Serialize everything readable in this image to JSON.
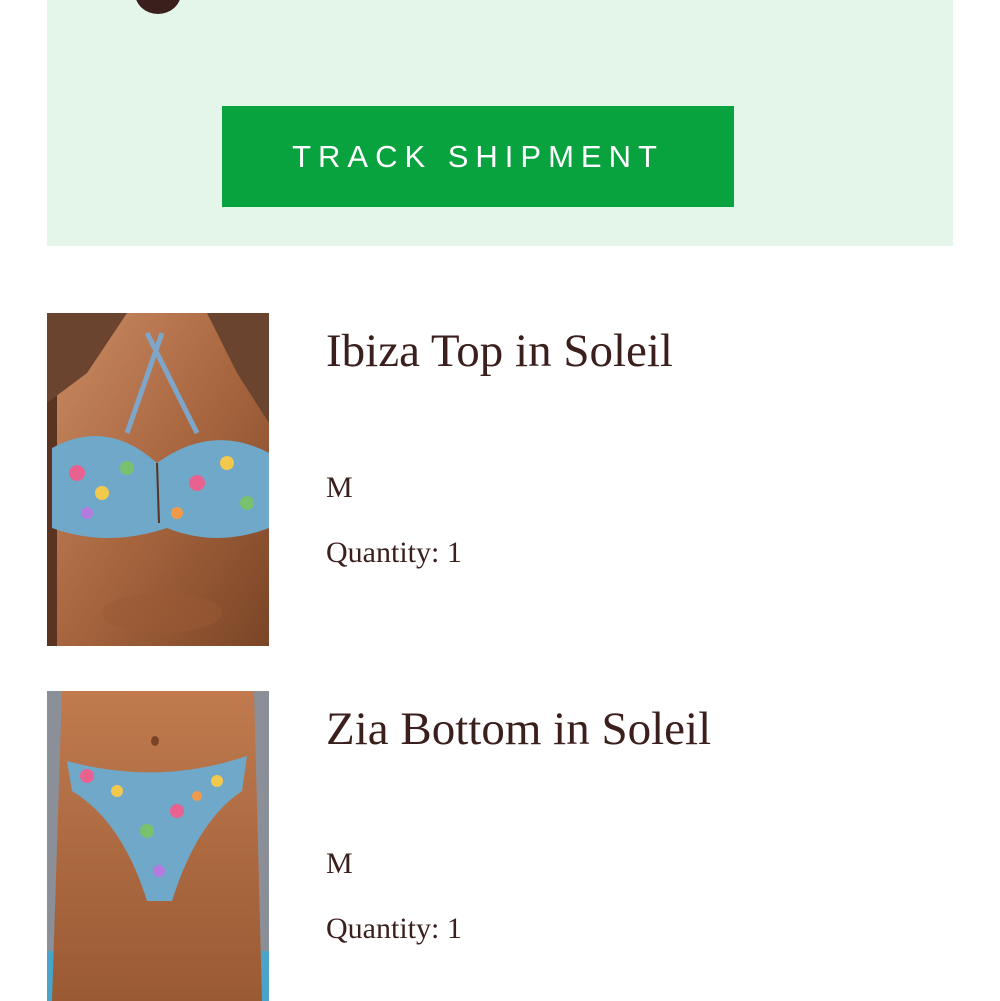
{
  "shipment": {
    "track_button_label": "TRACK SHIPMENT"
  },
  "items": [
    {
      "title": "Ibiza Top in Soleil",
      "size": "M",
      "quantity_label": "Quantity: 1",
      "image_alt": "product-photo-bikini-top"
    },
    {
      "title": "Zia Bottom in Soleil",
      "size": "M",
      "quantity_label": "Quantity: 1",
      "image_alt": "product-photo-bikini-bottom"
    }
  ],
  "colors": {
    "banner_background": "#e4f6e9",
    "button_green": "#08a33f",
    "text_brown": "#3a1f1c"
  }
}
